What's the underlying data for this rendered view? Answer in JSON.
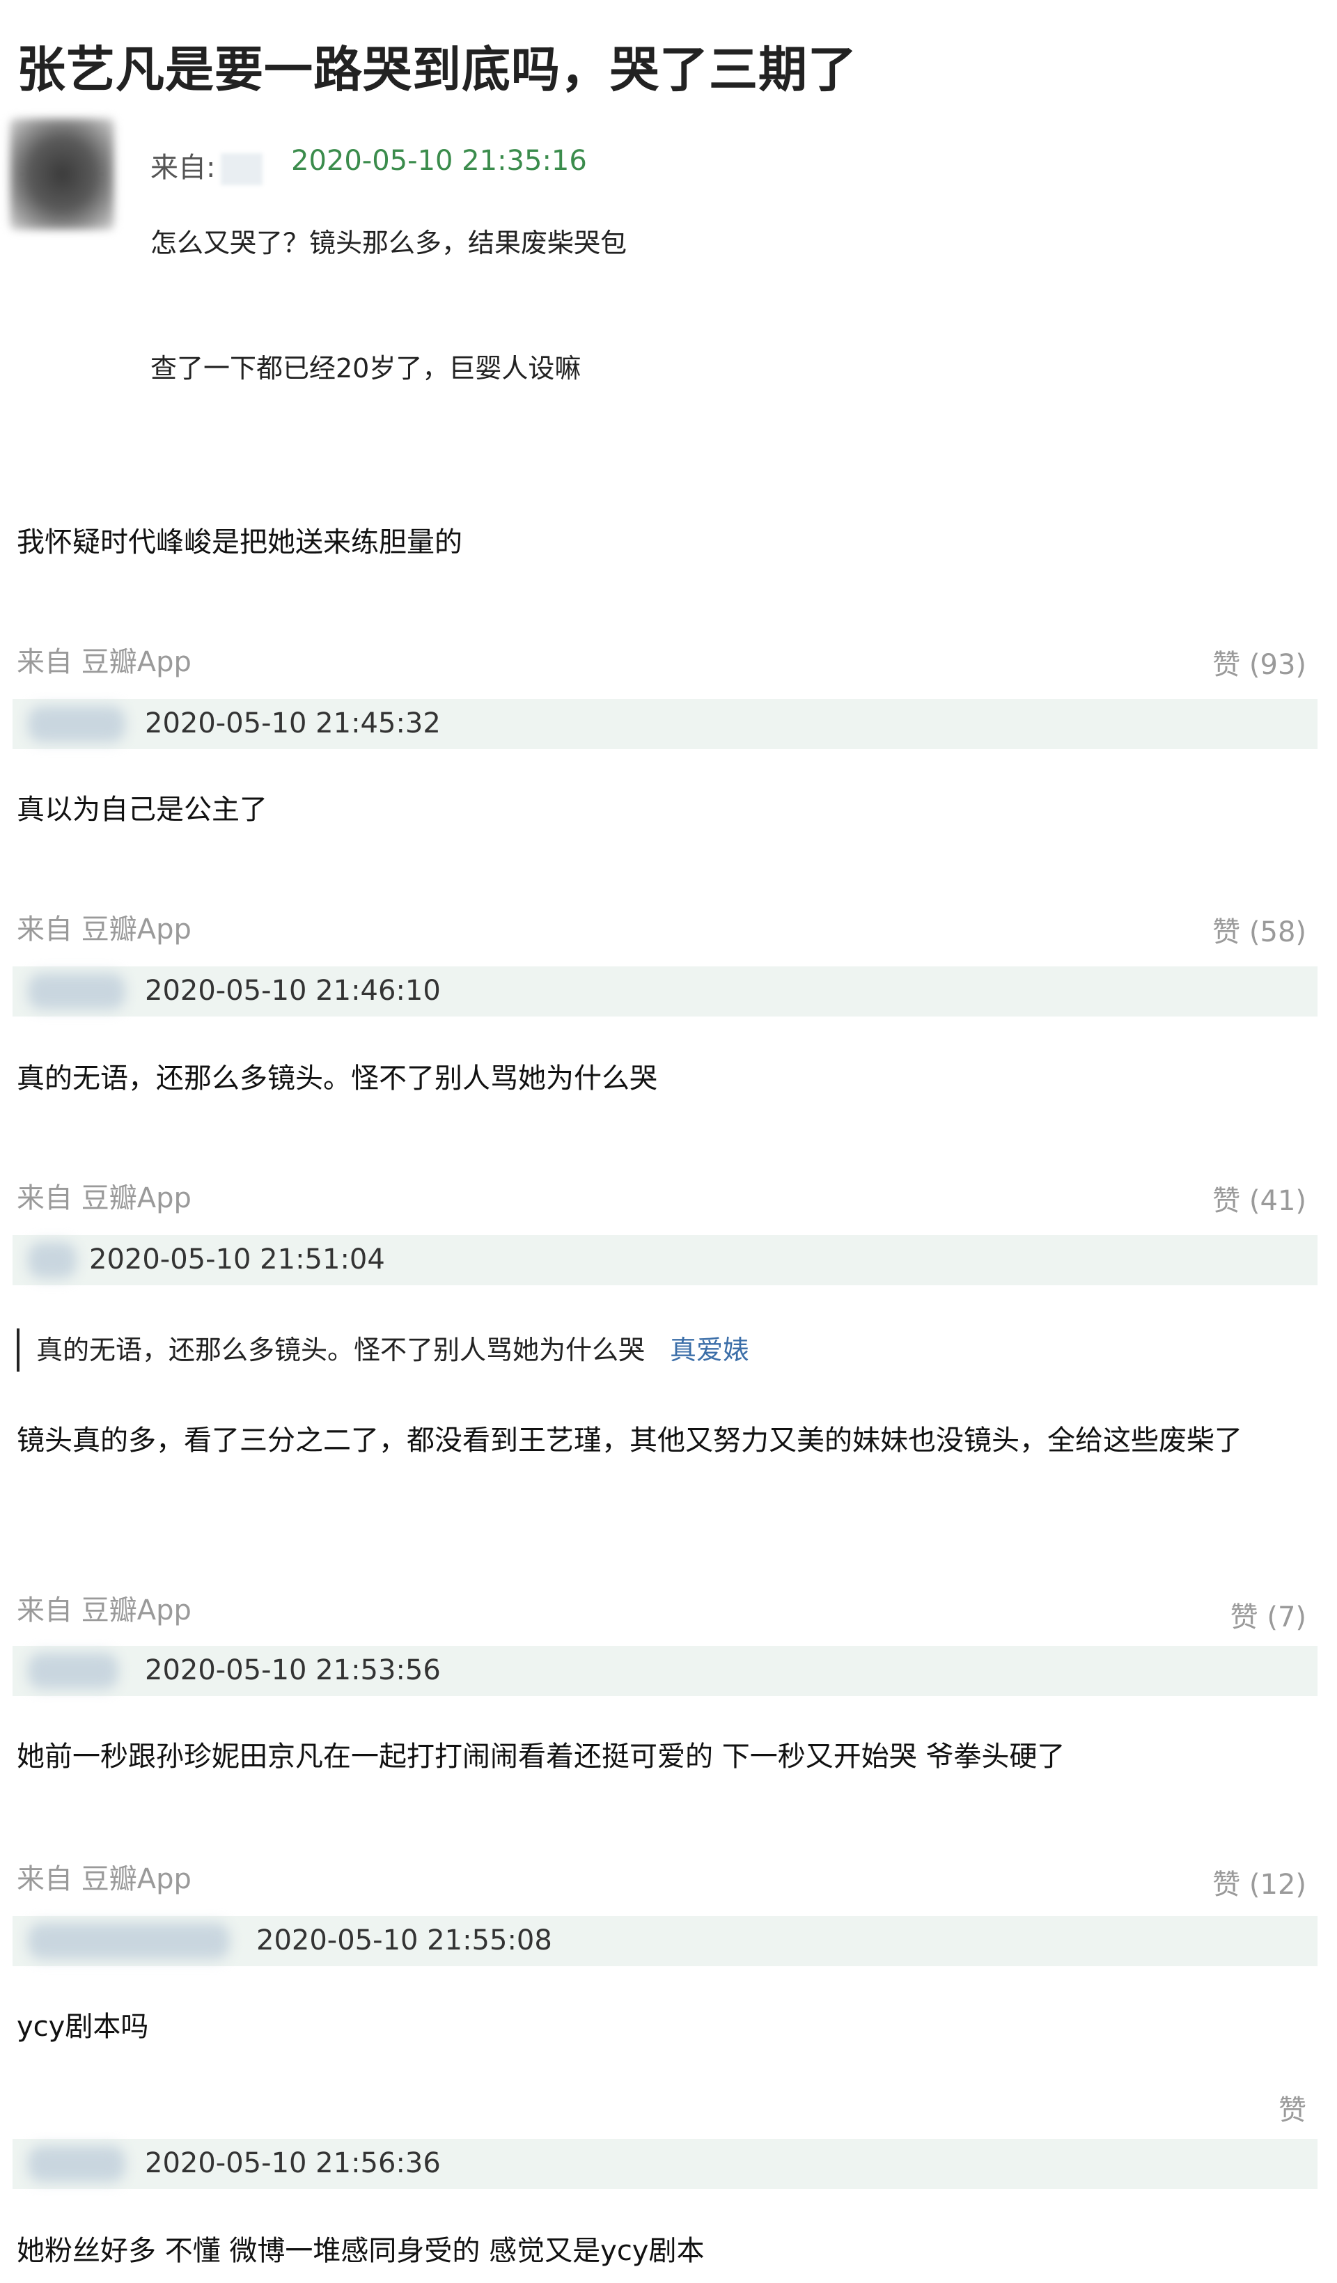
{
  "post": {
    "title": "张艺凡是要一路哭到底吗，哭了三期了",
    "from_label": "来自:",
    "timestamp": "2020-05-10 21:35:16",
    "lines": [
      "怎么又哭了？镜头那么多，结果废柴哭包",
      "查了一下都已经20岁了，巨婴人设嘛"
    ]
  },
  "comments": [
    {
      "text": "我怀疑时代峰峻是把她送来练胆量的",
      "source": "来自 豆瓣App",
      "like_label": "赞 (93)",
      "time": "2020-05-10 21:45:32"
    },
    {
      "text": "真以为自己是公主了",
      "source": "来自 豆瓣App",
      "like_label": "赞 (58)",
      "time": "2020-05-10 21:46:10"
    },
    {
      "text": "真的无语，还那么多镜头。怪不了别人骂她为什么哭",
      "source": "来自 豆瓣App",
      "like_label": "赞 (41)",
      "time": "2020-05-10 21:51:04"
    },
    {
      "quote_text": "真的无语，还那么多镜头。怪不了别人骂她为什么哭",
      "quote_author": "真爱婊",
      "text": "镜头真的多，看了三分之二了，都没看到王艺瑾，其他又努力又美的妹妹也没镜头，全给这些废柴了",
      "source": "来自 豆瓣App",
      "like_label": "赞 (7)",
      "time": "2020-05-10 21:53:56"
    },
    {
      "text": "她前一秒跟孙珍妮田京凡在一起打打闹闹看着还挺可爱的 下一秒又开始哭 爷拳头硬了",
      "source": "来自 豆瓣App",
      "like_label": "赞 (12)",
      "time": "2020-05-10 21:55:08"
    },
    {
      "text": "ycy剧本吗",
      "like_label": "赞",
      "time": "2020-05-10 21:56:36"
    },
    {
      "text": "她粉丝好多 不懂 微博一堆感同身受的 感觉又是ycy剧本"
    }
  ]
}
